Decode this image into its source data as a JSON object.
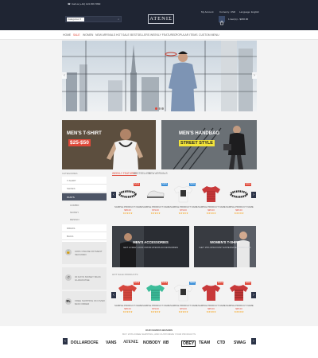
{
  "topbar": {
    "contact": "Call us (+44) 123 456 7890"
  },
  "header_right": {
    "account": "My Account",
    "currency": "Currency: USD",
    "language": "Language: English"
  },
  "search": {
    "category": "Categories"
  },
  "logo": "ATENIΣ",
  "cart": {
    "label": "1 item(s) - $180.00"
  },
  "nav": {
    "items": [
      "HOME",
      "SALE",
      "WOMEN",
      "NEW ARRIVALS",
      "HOT SALE",
      "BESTSELLERS",
      "WEEKLY FEATURED",
      "POPULAR ITEMS",
      "CUSTOM MENU"
    ]
  },
  "promo1": {
    "title": "MEN'S T-SHIRT",
    "price": "$25-$50"
  },
  "promo2": {
    "title": "MEN'S HANDBAG",
    "subtitle": "STREET STYLE"
  },
  "sidebar": {
    "heading": "CATEGORIES",
    "items": [
      "T-SHIRT",
      "SHOES",
      "PANTS",
      "DRESS",
      "BAGS",
      "ACCESSORIES"
    ],
    "subitems": [
      "COMBO",
      "SKINNY",
      "DESIGN"
    ],
    "features": [
      "100% ONLINE PAYMENT SECURED",
      "30 DAYS MONEY BACK GUARANTEE",
      "FREE SHIPPING ON OVER $100 ORDER"
    ]
  },
  "tabs": [
    "WEEKLY FEATURED",
    "BESTSELLER",
    "NEW ARRIVALS"
  ],
  "product_row1": [
    {
      "name": "SAMPLE PRODUCT NAME",
      "price": "$95.00",
      "badge": "SALE",
      "badge_color": "#e0493a"
    },
    {
      "name": "SAMPLE PRODUCT NAME",
      "price": "$79.00",
      "badge": "NEW",
      "badge_color": "#3a8fd8"
    },
    {
      "name": "SAMPLE PRODUCT NAME",
      "price": "$79.00",
      "badge": "NEW",
      "badge_color": "#3a8fd8"
    },
    {
      "name": "SAMPLE PRODUCT NAME",
      "price": "$95.00",
      "badge": "",
      "badge_color": ""
    },
    {
      "name": "SAMPLE PRODUCT NAME",
      "price": "$95.00",
      "badge": "SALE",
      "badge_color": "#e0493a"
    }
  ],
  "middle_banners": [
    {
      "title": "MEN'S ACCESSORIES",
      "subtitle": "GET A NEW LOOK FROM ATENIS ACCESSORIES"
    },
    {
      "title": "WOMEN'S T-SHIRT",
      "subtitle": "GET 15% DISCOUNT EXPENSIVE PRODUCTS"
    }
  ],
  "hot_sale_heading": "HOT SALE PRODUCTS",
  "product_row2": [
    {
      "name": "SAMPLE PRODUCT NAME",
      "price": "$95.00",
      "badge": "SALE",
      "badge_color": "#e0493a"
    },
    {
      "name": "SAMPLE PRODUCT NAME",
      "price": "$79.00",
      "badge": "SALE",
      "badge_color": "#e0493a"
    },
    {
      "name": "SAMPLE PRODUCT NAME",
      "price": "$79.00",
      "badge": "NEW",
      "badge_color": "#3a8fd8"
    },
    {
      "name": "SAMPLE PRODUCT NAME",
      "price": "$95.00",
      "badge": "SALE",
      "badge_color": "#e0493a"
    },
    {
      "name": "SAMPLE PRODUCT NAME",
      "price": "$95.00",
      "badge": "SALE",
      "badge_color": "#e0493a"
    }
  ],
  "brands": {
    "heading": "OUR FAMOUS BRANDS",
    "subheading": "BUY WITH FREE SHIPPING, AND CUSTOMIZE YOUR PRODUCTS",
    "items": [
      "DOLLAR",
      "DCFE",
      "VANS",
      "ATENIΣ",
      "NOBODY",
      "NB",
      "OBEY",
      "TEAM",
      "CTD",
      "SWAG"
    ]
  },
  "stars": "★★★★★"
}
